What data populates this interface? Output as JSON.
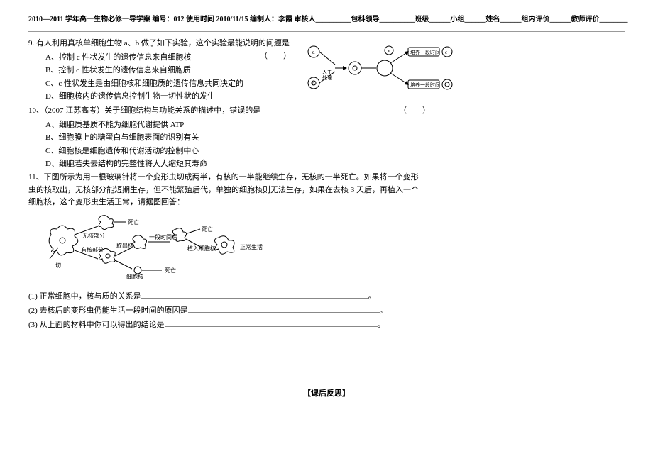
{
  "header": {
    "title": "2010—2011 学年高一生物必修一导学案  编号：012  使用时间 2010/11/15 编制人：李霞    审核人__________包科领导__________班级______小组______姓名______组内评价______教师评价________"
  },
  "q9": {
    "stem": "9. 有人利用真核单细胞生物 a、b 做了如下实验，这个实验最能说明的问题是",
    "paren": "（　　）",
    "optA": "A、控制 c 性状发生的遗传信息来自细胞核",
    "optB": "B、控制 c 性状发生的遗传信息来自细胞质",
    "optC": "C、c 性状发生是由细胞核和细胞质的遗传信息共同决定的",
    "optD": "D、细胞核内的遗传信息控制生物一切性状的发生"
  },
  "fig1": {
    "labels": {
      "a": "a",
      "b": "b",
      "x": "x",
      "c": "c",
      "l1": "人工",
      "l2": "处理",
      "t1": "培养一段时间",
      "t2": "培养一段时间"
    }
  },
  "q10": {
    "stem": "10、（2007 江苏高考）关于细胞结构与功能关系的描述中，错误的是",
    "paren": "（　　）",
    "optA": "A、细胞质基质不能为细胞代谢提供 ATP",
    "optB": "B、细胞膜上的糖蛋白与细胞表面的识别有关",
    "optC": "C、细胞核是细胞遗传和代谢活动的控制中心",
    "optD": "D、细胞若失去结构的完整性将大大缩短其寿命"
  },
  "q11": {
    "stem": "11、下图所示为用一根玻璃针将一个变形虫切成两半，有核的一半能继续生存，无核的一半死亡。如果将一个变形虫的核取出，无核部分能短期生存，但不能繁殖后代，单独的细胞核则无法生存，如果在去核 3 天后，再植入一个细胞核，这个变形虫生活正常，请据图回答："
  },
  "fig2": {
    "labels": {
      "die": "死亡",
      "wuhe": "无核部分",
      "qie": "切",
      "youhe": "有核部分",
      "bao": "取出核",
      "baoh": "细胞核",
      "time": "一段时间后",
      "zhiru": "植入细胞核",
      "zheng": "正常生活"
    }
  },
  "sub": {
    "s1": "(1) 正常细胞中，核与质的关系是",
    "s2": "(2) 去核后的变形虫仍能生活一段时间的原因是",
    "s3": "(3) 从上面的材料中你可以得出的结论是",
    "end": "。"
  },
  "reflection": "【课后反思】"
}
